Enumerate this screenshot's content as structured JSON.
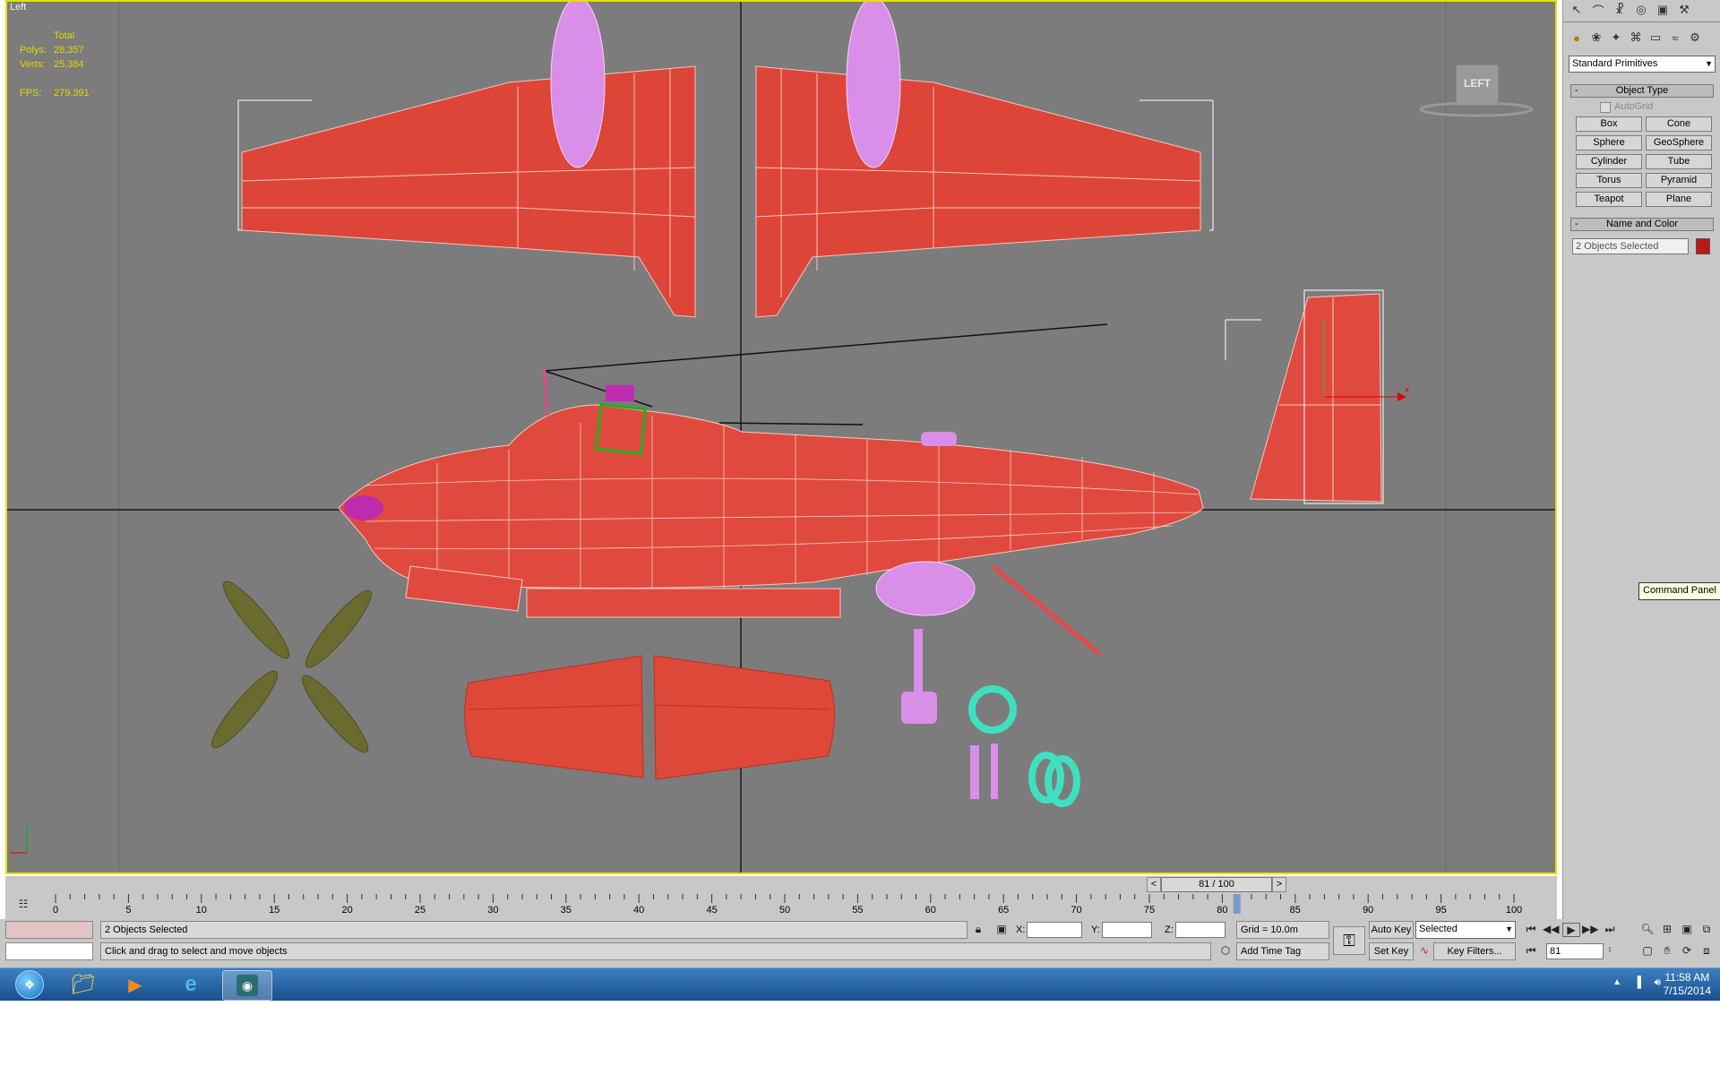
{
  "viewport": {
    "label": "Left",
    "stats": {
      "total_label": "Total",
      "polys_label": "Polys:",
      "polys_value": "28,357",
      "verts_label": "Verts:",
      "verts_value": "25,384",
      "fps_label": "FPS:",
      "fps_value": "279.391"
    },
    "viewcube_label": "LEFT",
    "axis_z": "z",
    "axis_x": "x"
  },
  "command_panel": {
    "category_dropdown": "Standard Primitives",
    "object_type": {
      "title": "Object Type",
      "collapse": "-",
      "autogrid_label": "AutoGrid",
      "buttons": [
        "Box",
        "Cone",
        "Sphere",
        "GeoSphere",
        "Cylinder",
        "Tube",
        "Torus",
        "Pyramid",
        "Teapot",
        "Plane"
      ]
    },
    "name_and_color": {
      "title": "Name and Color",
      "collapse": "-",
      "name_value": "2 Objects Selected",
      "color": "#c01818"
    },
    "tooltip": "Command Panel"
  },
  "timeline": {
    "slider_label": "81 / 100",
    "prev": "<",
    "next": ">",
    "ruler_labels": [
      "0",
      "5",
      "10",
      "15",
      "20",
      "25",
      "30",
      "35",
      "40",
      "45",
      "50",
      "55",
      "60",
      "65",
      "70",
      "75",
      "80",
      "85",
      "90",
      "95",
      "100"
    ],
    "current_frame": 81,
    "max_frame": 100
  },
  "status": {
    "selection_text": "2 Objects Selected",
    "prompt_text": "Click and drag to select and move objects",
    "x_label": "X:",
    "y_label": "Y:",
    "z_label": "Z:",
    "grid": "Grid = 10.0m",
    "add_time_tag": "Add Time Tag",
    "auto_key": "Auto Key",
    "set_key": "Set Key",
    "key_mode": "Selected",
    "key_filters": "Key Filters...",
    "frame_field": "81"
  },
  "taskbar": {
    "time": "11:58 AM",
    "date": "7/15/2014"
  },
  "colors": {
    "accent": "#e8e000",
    "model_red": "#e04a3e",
    "model_pink": "#d98ee8",
    "wheel_cyan": "#3fe0c0",
    "propeller": "#6b6b30"
  }
}
